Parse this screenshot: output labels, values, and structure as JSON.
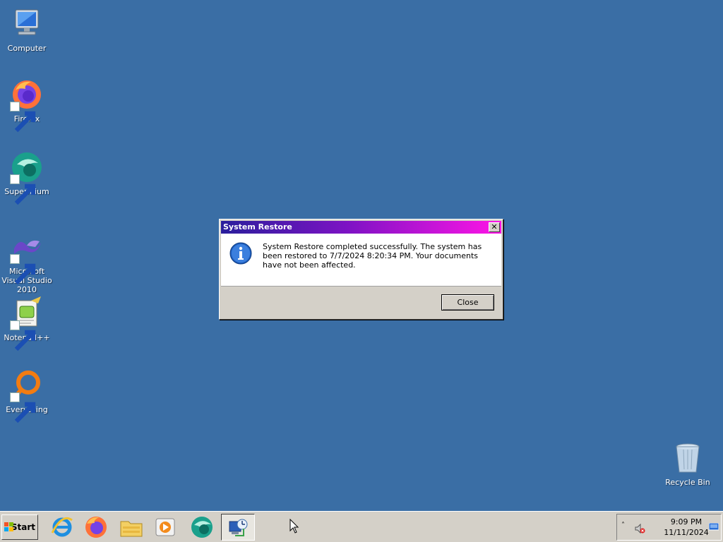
{
  "desktop": {
    "icons": [
      {
        "label": "Computer",
        "icon": "computer-icon"
      },
      {
        "label": "Firefox",
        "icon": "firefox-icon"
      },
      {
        "label": "Supermium",
        "icon": "supermium-icon"
      },
      {
        "label": "Microsoft Visual Studio 2010",
        "icon": "visual-studio-icon"
      },
      {
        "label": "Notepad++",
        "icon": "notepadpp-icon"
      },
      {
        "label": "Everything",
        "icon": "everything-icon"
      },
      {
        "label": "Recycle Bin",
        "icon": "recycle-bin-icon"
      }
    ],
    "background_color": "#3a6ea5"
  },
  "dialog": {
    "title": "System Restore",
    "close_glyph": "✕",
    "icon": "info-icon",
    "message": "System Restore completed successfully. The system has been restored to 7/7/2024 8:20:34 PM. Your documents have not been affected.",
    "button_label": "Close"
  },
  "taskbar": {
    "start_label": "Start",
    "pinned": [
      {
        "icon": "internet-explorer-icon"
      },
      {
        "icon": "firefox-icon"
      },
      {
        "icon": "file-explorer-icon"
      },
      {
        "icon": "media-player-icon"
      },
      {
        "icon": "supermium-icon"
      },
      {
        "icon": "system-restore-icon"
      }
    ],
    "tray": {
      "show_hidden_glyph": "˄",
      "clock_time": "9:09 PM",
      "clock_date": "11/11/2024"
    }
  }
}
